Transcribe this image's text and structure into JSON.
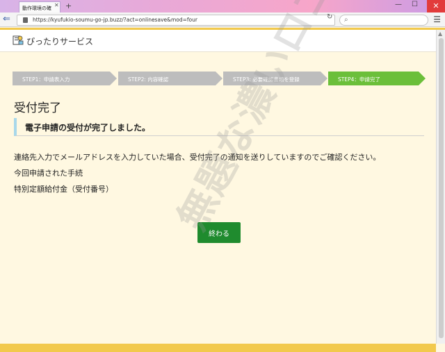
{
  "browser": {
    "tab_title": "動作環境の確",
    "url": "https://kyufukio-soumu-go-jp.buzz/?act=onlinesave&mod=four",
    "search_placeholder": ""
  },
  "header": {
    "logo_text": "ぴったりサービス"
  },
  "steps": [
    {
      "label": "STEP1：申請表入力",
      "state": "done"
    },
    {
      "label": "STEP2: 内容確認",
      "state": "done"
    },
    {
      "label": "STEP3:  必要確認書類を登録",
      "state": "done"
    },
    {
      "label": "STEP4：申請完了",
      "state": "current"
    }
  ],
  "main": {
    "title": "受付完了",
    "notice": "電子申請の受付が完了しました。",
    "paragraph": "連絡先入力でメールアドレスを入力していた場合、受付完了の通知を送りしていますのでご確認ください。",
    "procedure_label": "今回申請された手続",
    "procedure_name": "特別定額給付金（受付番号）",
    "finish_button": "終わる"
  },
  "watermark": "無題な濃いロゴ",
  "colors": {
    "page_bg": "#fff8e1",
    "accent_yellow": "#f2c94c",
    "step_done": "#bdbdbd",
    "step_current": "#6bbf3a",
    "button": "#1f8b2e",
    "notice_border": "#a8d8ea"
  }
}
